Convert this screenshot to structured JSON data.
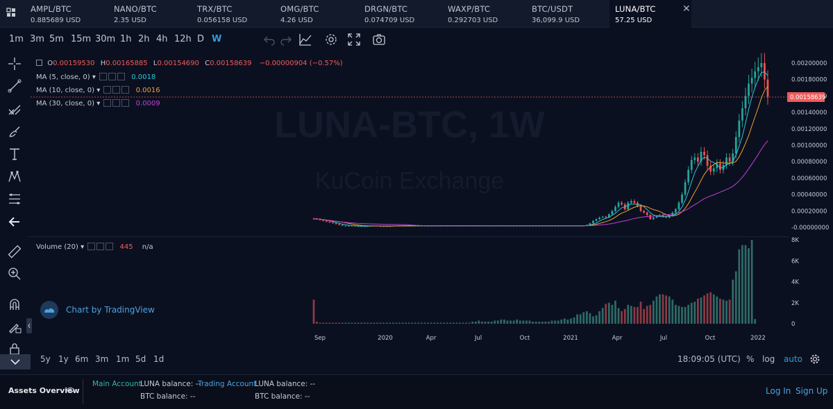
{
  "tickers": [
    {
      "symbol": "AMPL/BTC",
      "price": "0.885689 USD"
    },
    {
      "symbol": "NANO/BTC",
      "price": "2.35 USD"
    },
    {
      "symbol": "TRX/BTC",
      "price": "0.056158 USD"
    },
    {
      "symbol": "OMG/BTC",
      "price": "4.26 USD"
    },
    {
      "symbol": "DRGN/BTC",
      "price": "0.074709 USD"
    },
    {
      "symbol": "WAXP/BTC",
      "price": "0.292703 USD"
    },
    {
      "symbol": "BTC/USDT",
      "price": "36,099.9 USD"
    },
    {
      "symbol": "LUNA/BTC",
      "price": "57.25 USD",
      "active": true
    }
  ],
  "toolbar": {
    "timeframes": [
      "1m",
      "3m",
      "5m",
      "15m",
      "30m",
      "1h",
      "2h",
      "4h",
      "12h",
      "D",
      "W"
    ],
    "active_timeframe": "W",
    "icons": [
      "undo-icon",
      "redo-icon",
      "indicator-icon",
      "settings-icon",
      "fullscreen-icon",
      "camera-icon"
    ]
  },
  "sidebar_icons": [
    "crosshair-icon",
    "trend-line-icon",
    "pitchfork-icon",
    "brush-icon",
    "text-icon",
    "pattern-icon",
    "fib-icon",
    "back-arrow-icon",
    "ruler-icon",
    "zoom-icon",
    "magnet-icon",
    "lock-drawing-icon",
    "lock-icon"
  ],
  "legend": {
    "ohlc": {
      "o_label": "O",
      "o": "0.00159530",
      "h_label": "H",
      "h": "0.00165885",
      "l_label": "L",
      "l": "0.00154690",
      "c_label": "C",
      "c": "0.00158639",
      "change": "−0.00000904 (−0.57%)"
    },
    "ma5": {
      "label": "MA (5, close, 0)",
      "value": "0.0018",
      "color": "#2fc6d8"
    },
    "ma10": {
      "label": "MA (10, close, 0)",
      "value": "0.0016",
      "color": "#f0a030"
    },
    "ma30": {
      "label": "MA (30, close, 0)",
      "value": "0.0009",
      "color": "#c040d8"
    },
    "volume": {
      "label": "Volume (20)",
      "value": "445",
      "extra": "n/a"
    }
  },
  "watermark": {
    "line1": "LUNA-BTC, 1W",
    "line2": "KuCoin Exchange"
  },
  "branding": {
    "text": "Chart by TradingView"
  },
  "price_axis": {
    "labels": [
      "0.00200000",
      "0.00180000",
      "0.00160000",
      "0.00140000",
      "0.00120000",
      "0.00100000",
      "0.00080000",
      "0.00060000",
      "0.00040000",
      "0.00020000",
      "-0.00000000"
    ],
    "current_price": "0.00158639"
  },
  "volume_axis": {
    "labels": [
      "8K",
      "6K",
      "4K",
      "2K",
      "0"
    ]
  },
  "time_axis": {
    "labels": [
      "Sep",
      "2020",
      "Apr",
      "Jul",
      "Oct",
      "2021",
      "Apr",
      "Jul",
      "Oct",
      "2022"
    ]
  },
  "chart_data": {
    "type": "candlestick",
    "title": "LUNA-BTC, 1W",
    "x_ticks": [
      "Sep",
      "2020",
      "Apr",
      "Jul",
      "Oct",
      "2021",
      "Apr",
      "Jul",
      "Oct",
      "2022"
    ],
    "ylim": [
      -1e-05,
      0.00215
    ],
    "price_close_approx": [
      0.000105,
      0.0001,
      9e-05,
      8e-05,
      7e-05,
      6e-05,
      5e-05,
      4e-05,
      3e-05,
      2e-05,
      2e-05,
      2e-05,
      2e-05,
      1.5e-05,
      1.5e-05,
      1.5e-05,
      1.5e-05,
      1.5e-05,
      2e-05,
      2e-05,
      1.5e-05,
      1.5e-05,
      1.5e-05,
      1.5e-05,
      1.5e-05,
      2e-05,
      2e-05,
      2e-05,
      2e-05,
      2e-05,
      2e-05,
      2e-05,
      2e-05,
      2e-05,
      2e-05,
      2e-05,
      2e-05,
      2e-05,
      2e-05,
      2e-05,
      2e-05,
      2e-05,
      2e-05,
      2e-05,
      2e-05,
      2e-05,
      2e-05,
      2e-05,
      2e-05,
      2e-05,
      2e-05,
      2e-05,
      2e-05,
      2e-05,
      2e-05,
      2e-05,
      2e-05,
      2e-05,
      2e-05,
      2e-05,
      2e-05,
      2e-05,
      2e-05,
      2e-05,
      2e-05,
      2e-05,
      2e-05,
      2e-05,
      2e-05,
      2e-05,
      2e-05,
      2e-05,
      2e-05,
      2e-05,
      2e-05,
      2e-05,
      2e-05,
      2e-05,
      2e-05,
      2e-05,
      2e-05,
      2e-05,
      2e-05,
      2e-05,
      2e-05,
      2e-05,
      3e-05,
      5e-05,
      8e-05,
      0.0001,
      0.00012,
      0.00013,
      0.00012,
      0.00016,
      0.0002,
      0.00025,
      0.0003,
      0.00028,
      0.00022,
      0.0003,
      0.00032,
      0.0003,
      0.00026,
      0.0002,
      0.00018,
      0.00015,
      0.0001,
      0.00012,
      0.00014,
      0.00015,
      0.00013,
      0.00012,
      0.00014,
      0.00018,
      0.00022,
      0.0003,
      0.0004,
      0.00055,
      0.0007,
      0.00082,
      0.00085,
      0.0008,
      0.00092,
      0.00088,
      0.00075,
      0.00068,
      0.00072,
      0.00078,
      0.0007,
      0.00076,
      0.00085,
      0.0008,
      0.0009,
      0.0011,
      0.0013,
      0.00145,
      0.0016,
      0.00175,
      0.00182,
      0.0019,
      0.00195,
      0.002,
      0.0018,
      0.00159
    ],
    "volume_approx": [
      2300,
      200,
      100,
      100,
      100,
      100,
      100,
      100,
      100,
      100,
      100,
      100,
      100,
      100,
      100,
      100,
      100,
      100,
      100,
      100,
      100,
      100,
      100,
      100,
      100,
      100,
      100,
      100,
      100,
      100,
      100,
      100,
      100,
      100,
      100,
      100,
      100,
      100,
      100,
      100,
      100,
      100,
      100,
      100,
      100,
      100,
      100,
      100,
      100,
      100,
      200,
      200,
      300,
      200,
      200,
      200,
      200,
      300,
      300,
      400,
      400,
      300,
      300,
      300,
      400,
      300,
      300,
      300,
      300,
      200,
      200,
      200,
      200,
      200,
      200,
      300,
      300,
      300,
      400,
      500,
      400,
      500,
      600,
      900,
      900,
      1100,
      1200,
      1000,
      700,
      800,
      1200,
      1500,
      1900,
      2000,
      1800,
      2200,
      1500,
      1200,
      1400,
      1800,
      1700,
      1600,
      1600,
      2100,
      1400,
      1700,
      1800,
      2200,
      2600,
      2800,
      2800,
      2700,
      2600,
      2300,
      1800,
      1700,
      1600,
      1600,
      1800,
      2000,
      2100,
      2400,
      2500,
      2700,
      2900,
      3000,
      2800,
      2600,
      2400,
      2300,
      2200,
      2300,
      4200,
      5000,
      7100,
      7500,
      7500,
      7200,
      8000,
      445
    ]
  },
  "bottom_bar": {
    "ranges": [
      "5y",
      "1y",
      "6m",
      "3m",
      "1m",
      "5d",
      "1d"
    ],
    "time": "18:09:05 (UTC)",
    "percent": "%",
    "log": "log",
    "auto": "auto"
  },
  "footer": {
    "assets_label": "Assets Overview",
    "main_account": "Main Account",
    "trading_account": "Trading Account",
    "luna_balance_label": "LUNA balance:",
    "btc_balance_label": "BTC balance:",
    "balance_value": "--",
    "login": "Log In",
    "signup": "Sign Up"
  }
}
